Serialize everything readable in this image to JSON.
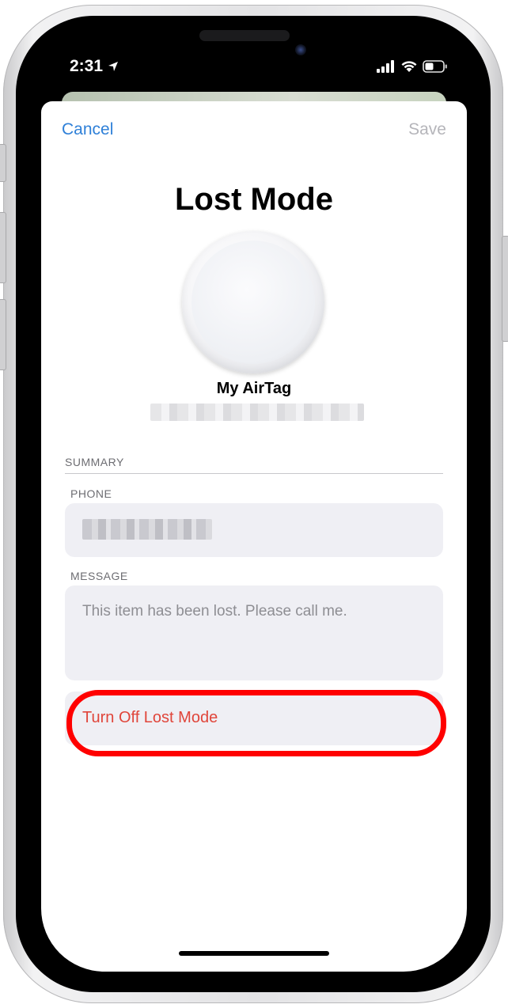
{
  "status_bar": {
    "time": "2:31",
    "location_icon": "location-arrow-icon",
    "signal_icon": "cellular-signal-icon",
    "wifi_icon": "wifi-icon",
    "battery_icon": "battery-icon"
  },
  "nav": {
    "cancel_label": "Cancel",
    "save_label": "Save"
  },
  "page": {
    "title": "Lost Mode"
  },
  "device": {
    "name": "My AirTag",
    "image_icon": "airtag-image",
    "subtitle_redacted": "redacted"
  },
  "summary": {
    "header": "SUMMARY",
    "phone_label": "PHONE",
    "phone_value_redacted": "redacted",
    "message_label": "MESSAGE",
    "message_value": "This item has been lost. Please call me."
  },
  "actions": {
    "turn_off_label": "Turn Off Lost Mode"
  },
  "colors": {
    "accent_blue": "#2f80d8",
    "disabled_gray": "#b5b5ba",
    "destructive_red": "#e0453a",
    "highlight_red": "#ff0000",
    "field_background": "#efeff4"
  }
}
